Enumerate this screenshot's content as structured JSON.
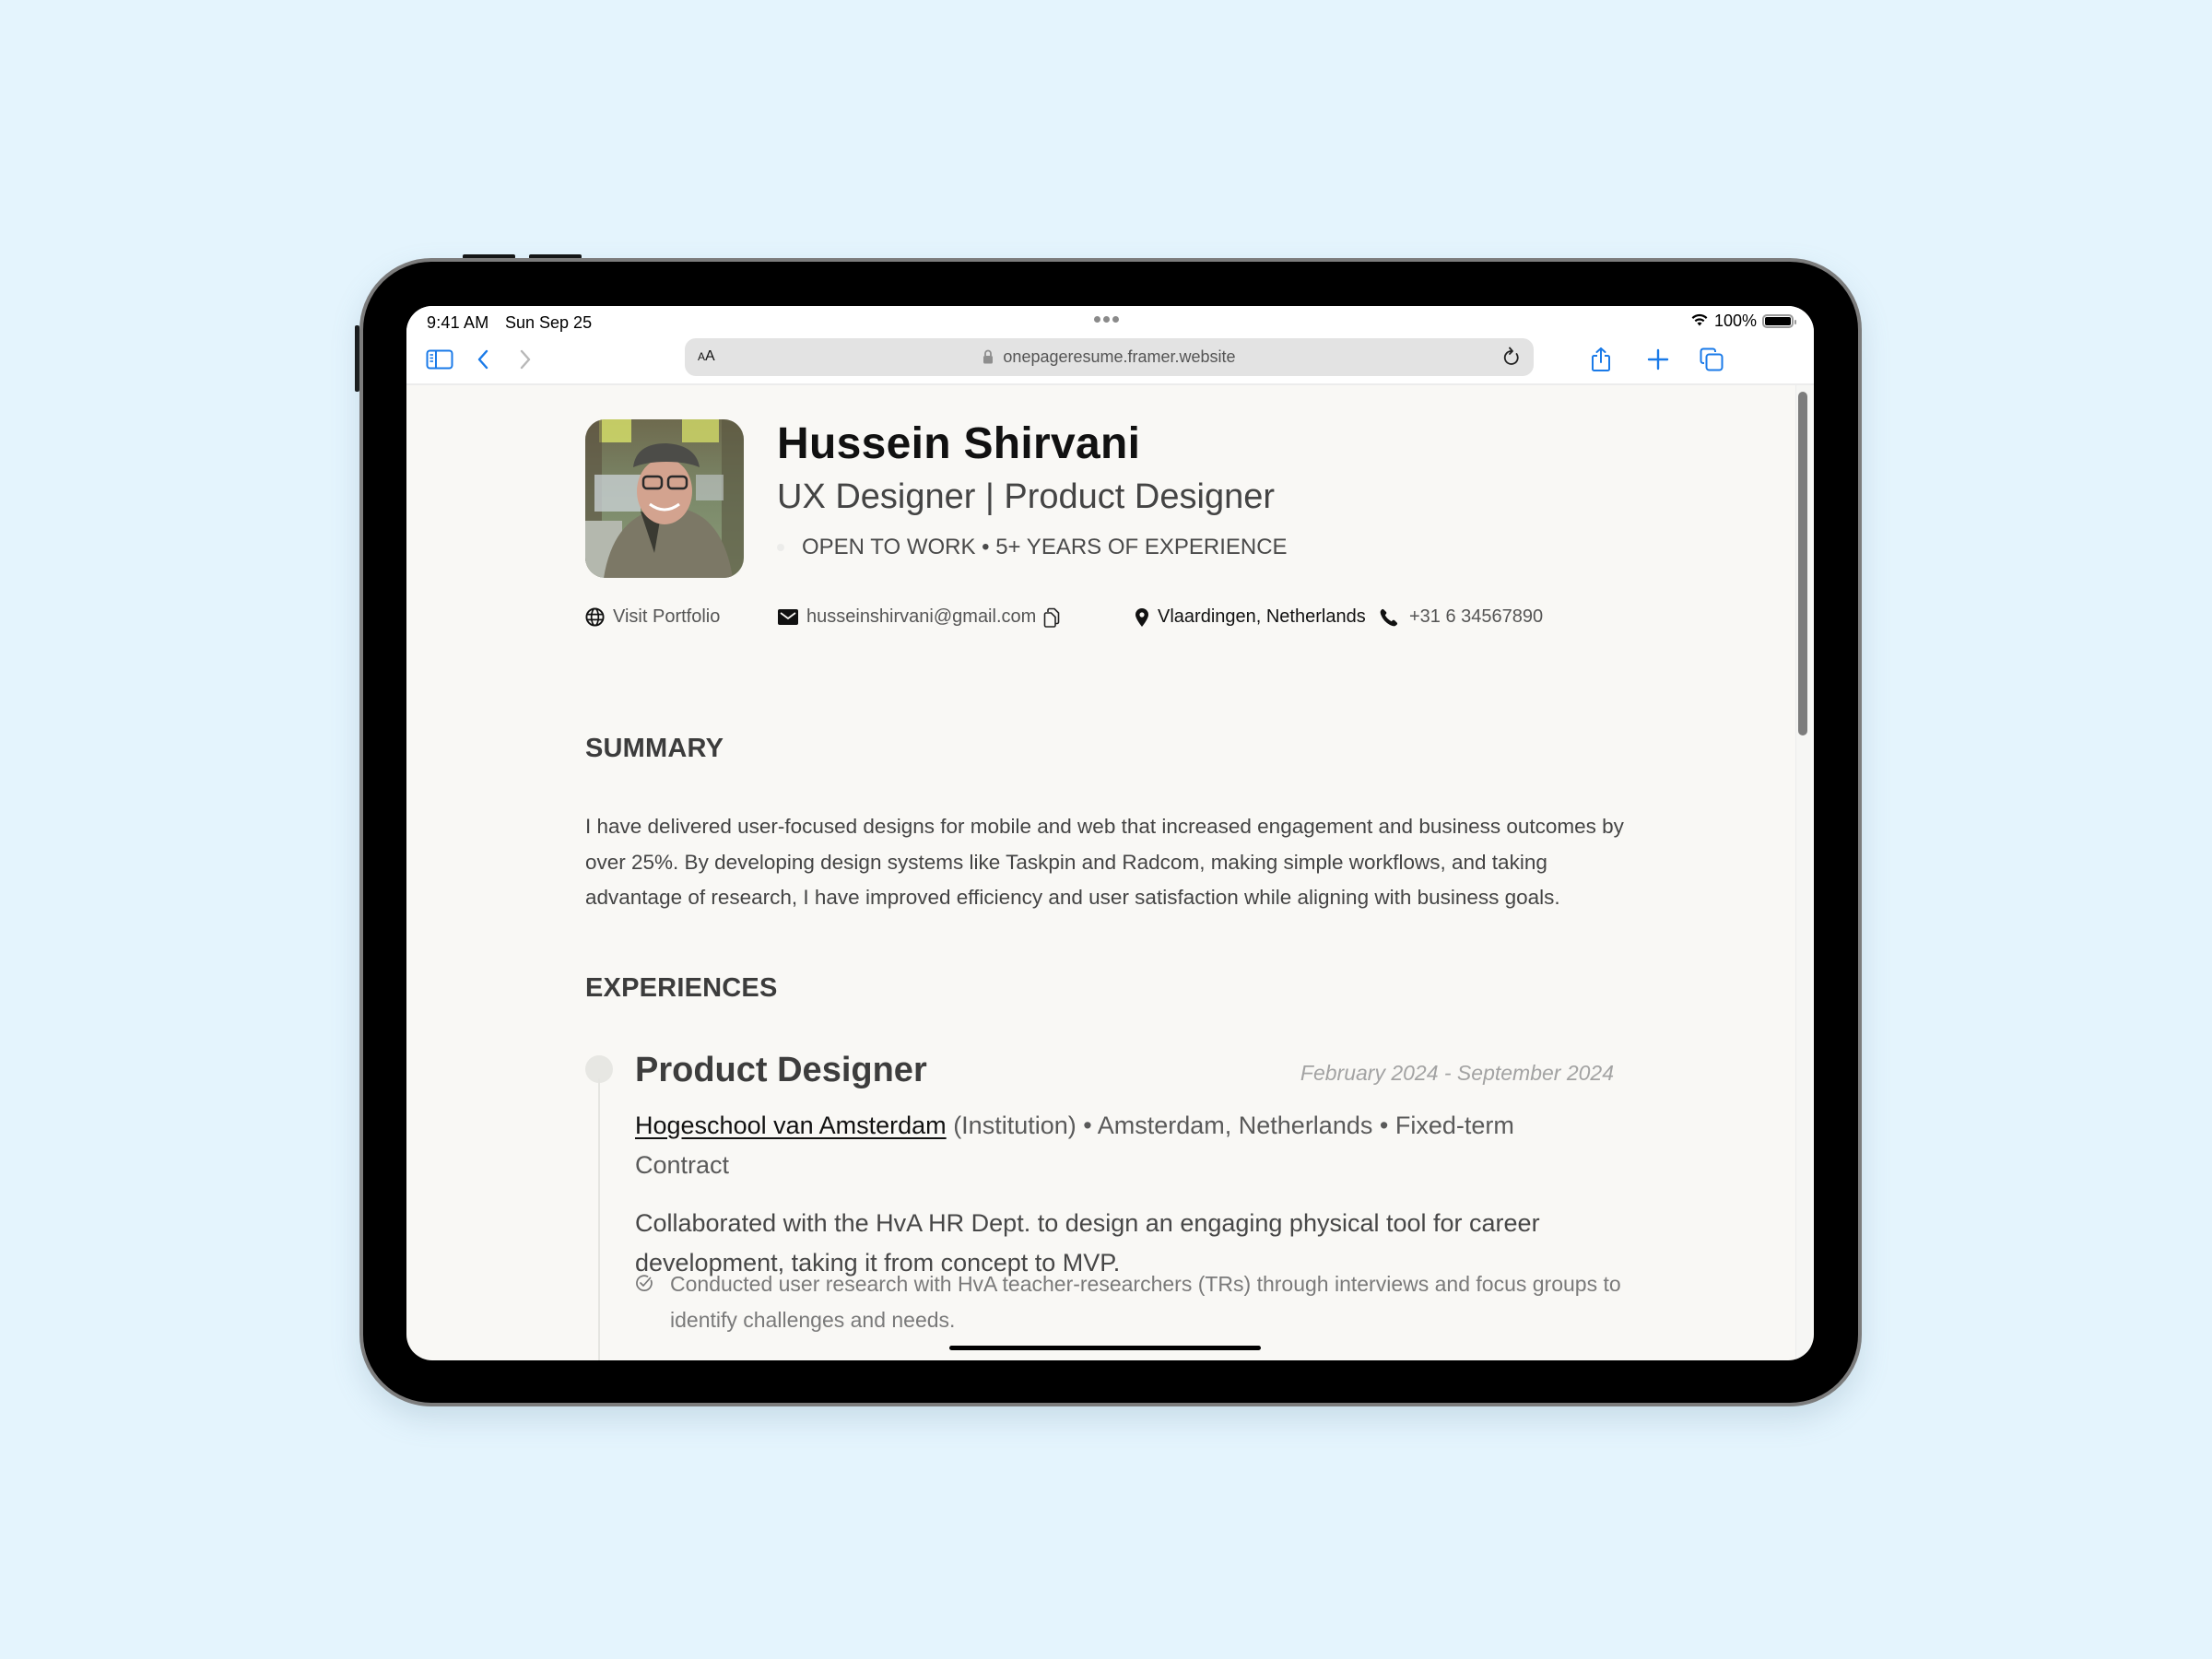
{
  "status_bar": {
    "time": "9:41 AM",
    "date": "Sun Sep 25",
    "battery_percent": "100%",
    "battery_level": 1.0
  },
  "toolbar": {
    "text_size_label": "AA",
    "url": "onepageresume.framer.website",
    "icons": [
      "sidebar-icon",
      "back-icon",
      "forward-icon",
      "lock-icon",
      "reload-icon",
      "share-icon",
      "new-tab-icon",
      "tabs-icon"
    ]
  },
  "profile": {
    "name": "Hussein Shirvani",
    "role": "UX Designer | Product Designer",
    "status": "OPEN TO WORK • 5+ YEARS OF EXPERIENCE"
  },
  "contacts": {
    "portfolio": "Visit Portfolio",
    "email": "husseinshirvani@gmail.com",
    "location": "Vlaardingen, Netherlands",
    "phone": "+31 6 34567890"
  },
  "summary": {
    "heading": "SUMMARY",
    "text": "I have delivered user-focused designs for mobile and web that increased engagement and business outcomes by over 25%. By developing design systems like Taskpin and Radcom, making simple workflows, and taking advantage of research, I have improved efficiency and user satisfaction while aligning with business goals."
  },
  "experiences": {
    "heading": "EXPERIENCES",
    "items": [
      {
        "title": "Product Designer",
        "dates": "February 2024 - September 2024",
        "organization": "Hogeschool van Amsterdam",
        "org_type": "(Institution)",
        "location": "Amsterdam, Netherlands",
        "contract": "Fixed-term Contract",
        "separator": "•",
        "description": "Collaborated with the HvA HR Dept. to design an engaging physical tool for career development, taking it from concept to MVP.",
        "bullets": [
          "Conducted user research with HvA teacher-researchers (TRs) through interviews and focus groups to identify challenges and needs."
        ]
      }
    ]
  },
  "colors": {
    "accent_blue": "#1a7ae8",
    "page_background": "#e4f4fd",
    "content_background": "#f9f8f5"
  }
}
